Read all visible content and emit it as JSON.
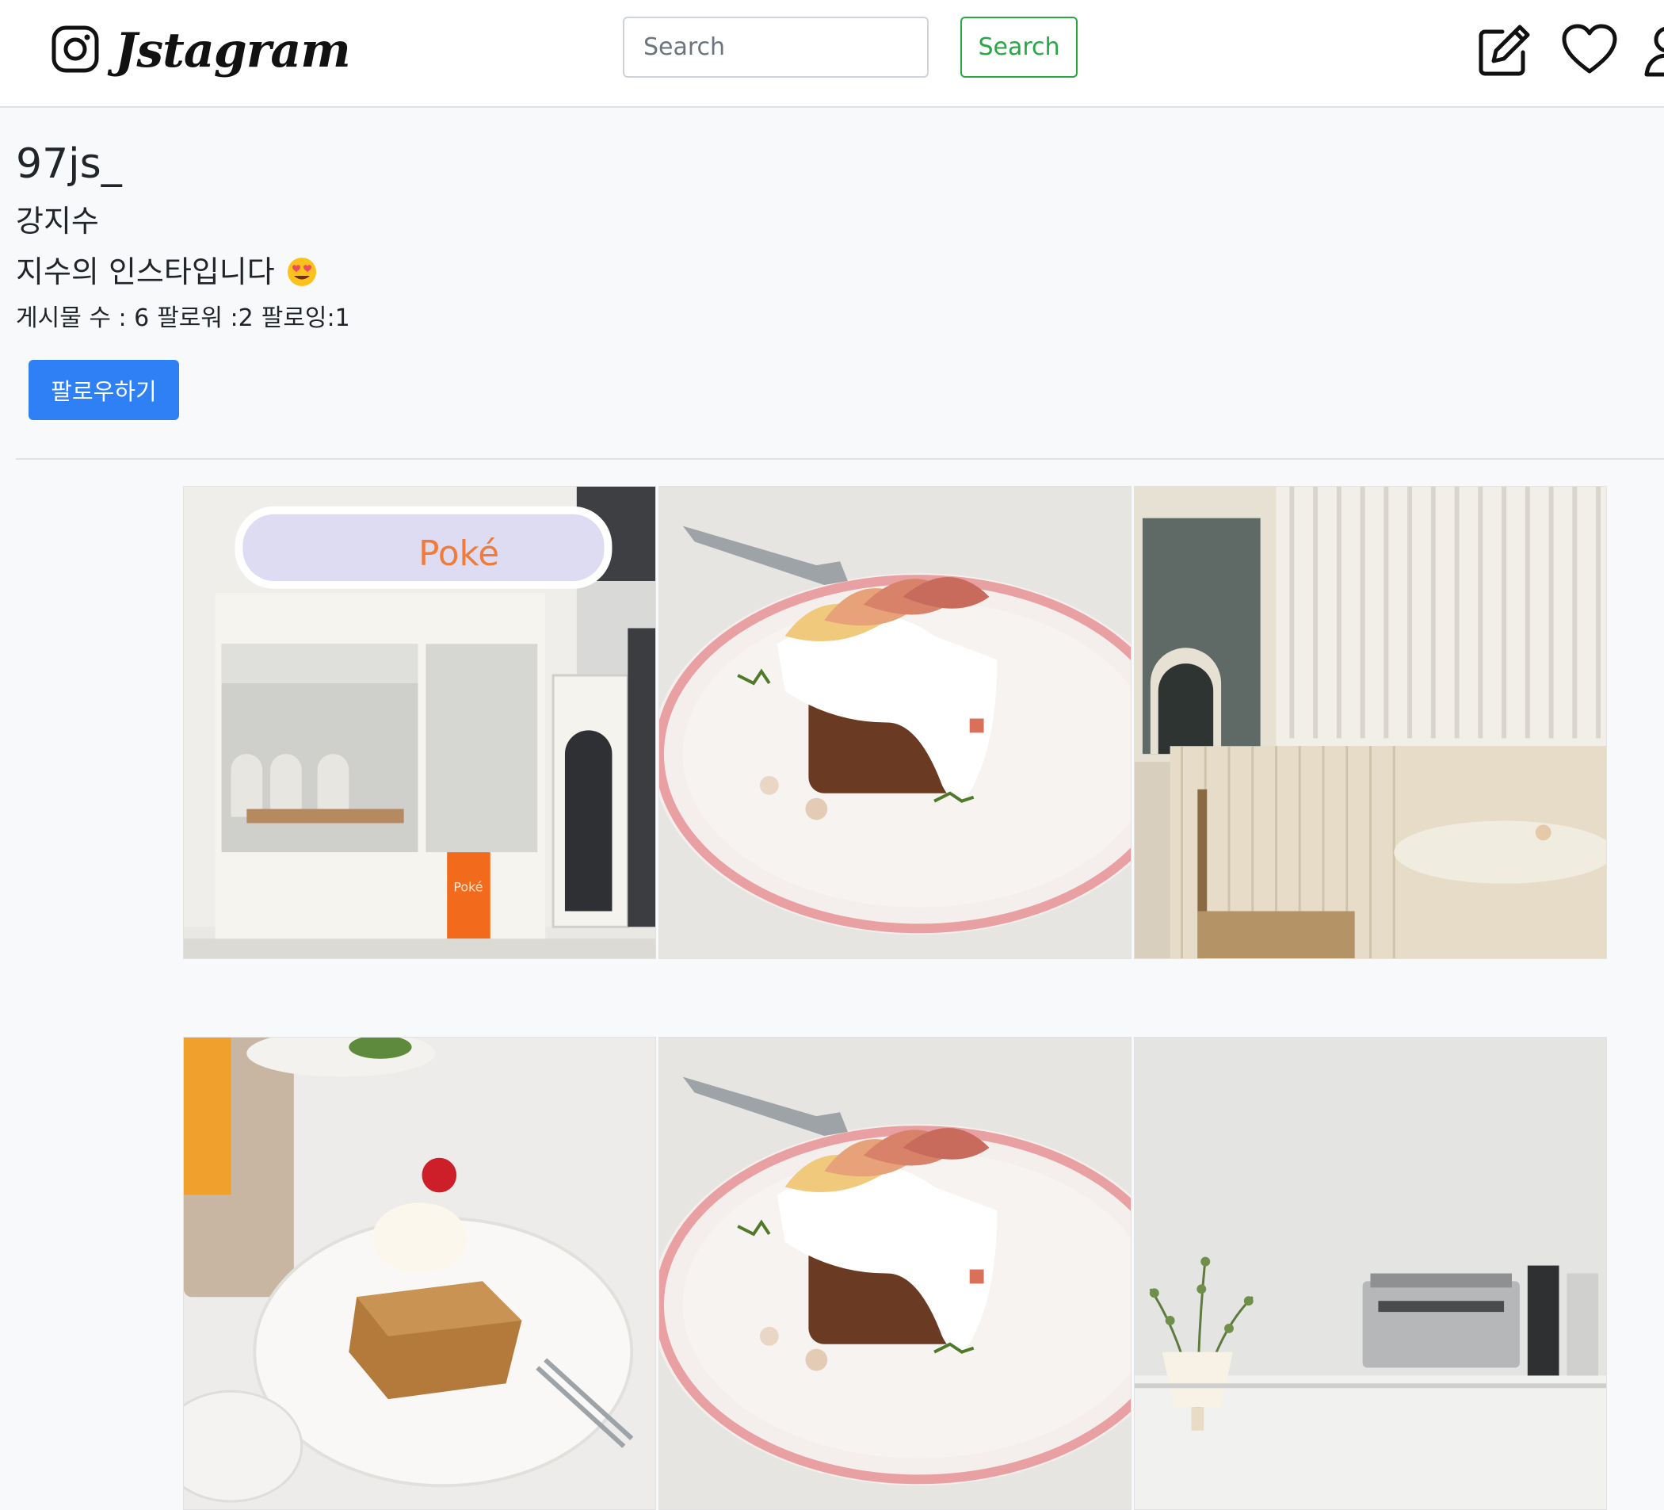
{
  "navbar": {
    "brand": "Jstagram",
    "search_placeholder": "Search",
    "search_button": "Search",
    "icons": [
      "instagram-icon",
      "pencil-square-icon",
      "heart-icon",
      "person-icon"
    ]
  },
  "profile": {
    "username": "97js_",
    "name": "강지수",
    "bio": "지수의 인스타입니다",
    "bio_emoji": "heart-eyes-emoji",
    "stats": {
      "posts": "게시물 수 : 6",
      "followers": "팔로워 :2",
      "following": "팔로잉:1"
    },
    "follow_button": "팔로우하기"
  },
  "posts": {
    "post1": {
      "sign_text": "Poké",
      "board_text": "Poké"
    },
    "post2": {},
    "post3": {},
    "post4": {},
    "post5": {},
    "post6": {}
  },
  "colors": {
    "accent_blue": "#2f80f5",
    "search_green": "#28a745",
    "page_bg": "#f8f9fa",
    "poke_orange": "#f26b1d"
  }
}
